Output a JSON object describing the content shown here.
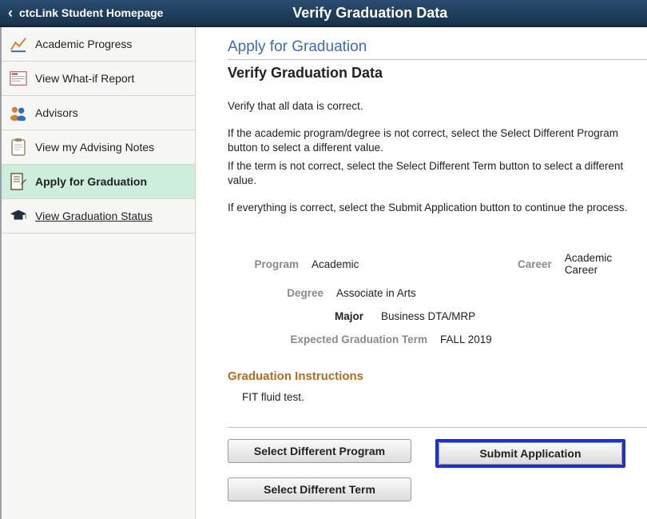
{
  "header": {
    "back_label": "ctcLink Student Homepage",
    "page_title": "Verify Graduation Data"
  },
  "sidebar": {
    "items": [
      {
        "label": "Academic Progress"
      },
      {
        "label": "View What-if Report"
      },
      {
        "label": "Advisors"
      },
      {
        "label": "View my Advising Notes"
      },
      {
        "label": "Apply for Graduation"
      },
      {
        "label": "View Graduation Status"
      }
    ]
  },
  "main": {
    "apply_heading": "Apply for Graduation",
    "verify_heading": "Verify Graduation Data",
    "p1": "Verify that all data is correct.",
    "p2a": "If the academic program/degree is not correct, select the Select Different Program button to select a different value.",
    "p2b": "If the term is not correct, select the Select Different Term button to select a different value.",
    "p3": "If everything is correct, select the Submit Application button to continue the process.",
    "labels": {
      "program": "Program",
      "career": "Career",
      "degree": "Degree",
      "major": "Major",
      "expected_term": "Expected Graduation Term"
    },
    "values": {
      "program": "Academic",
      "career": "Academic Career",
      "degree": "Associate in Arts",
      "major": "Business DTA/MRP",
      "expected_term": "FALL 2019"
    },
    "grad_instructions_heading": "Graduation Instructions",
    "grad_instructions_body": "FIT fluid test.",
    "buttons": {
      "select_program": "Select Different Program",
      "submit": "Submit Application",
      "select_term": "Select Different Term"
    }
  }
}
